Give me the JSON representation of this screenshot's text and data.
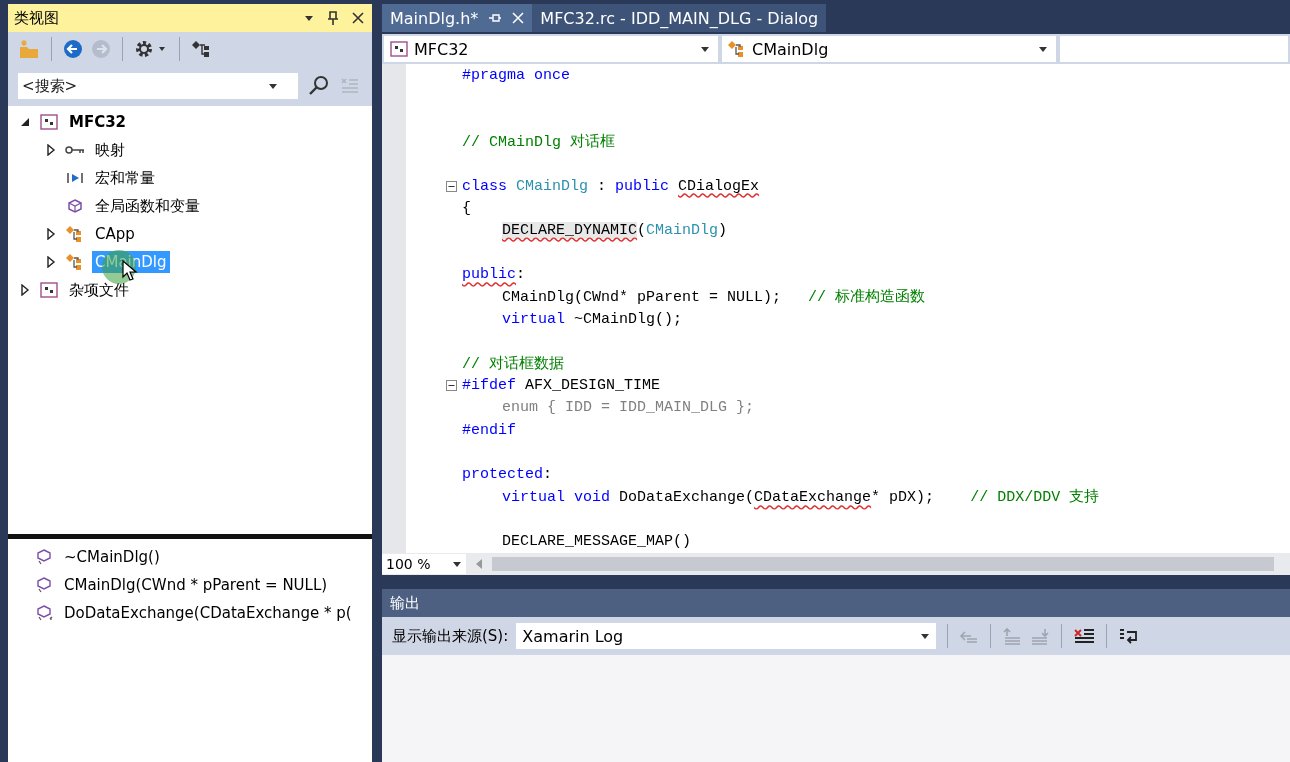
{
  "class_view": {
    "title": "类视图",
    "toolbar": [
      {
        "kind": "new-folder",
        "disabled": false
      },
      {
        "kind": "back",
        "disabled": false
      },
      {
        "kind": "forward",
        "disabled": true
      },
      {
        "kind": "settings",
        "disabled": false
      },
      {
        "kind": "class-diagram",
        "disabled": false
      }
    ],
    "search": {
      "placeholder": "<搜索>"
    },
    "tree": [
      {
        "label": "MFC32",
        "kind": "project",
        "startup": true,
        "expanded": true,
        "selected": false,
        "children": [
          {
            "label": "映射",
            "kind": "map",
            "expanded": false,
            "selected": false
          },
          {
            "label": "宏和常量",
            "kind": "macro",
            "selected": false
          },
          {
            "label": "全局函数和变量",
            "kind": "global",
            "selected": false
          },
          {
            "label": "CApp",
            "kind": "class",
            "expanded": false,
            "selected": false
          },
          {
            "label": "CMainDlg",
            "kind": "class",
            "expanded": false,
            "selected": true
          }
        ]
      },
      {
        "label": "杂项文件",
        "kind": "project",
        "startup": false,
        "expanded": false,
        "selected": false
      }
    ],
    "members": [
      {
        "label": "~CMainDlg()",
        "kind": "public"
      },
      {
        "label": "CMainDlg(CWnd * pParent = NULL)",
        "kind": "public"
      },
      {
        "label": "DoDataExchange(CDataExchange * p(",
        "kind": "protected"
      }
    ]
  },
  "editor": {
    "tabs": [
      {
        "label": "MainDlg.h*",
        "selected": true
      },
      {
        "label": "MFC32.rc - IDD_MAIN_DLG - Dialog",
        "selected": false
      }
    ],
    "nav": [
      {
        "kind": "project",
        "value": "MFC32"
      },
      {
        "kind": "class",
        "value": "CMainDlg"
      },
      {
        "kind": "empty"
      }
    ],
    "lines": [
      {
        "kind": "flush",
        "tokens": [
          {
            "t": "#pragma once",
            "kind": "keyword"
          }
        ]
      },
      {
        "kind": "blank"
      },
      {
        "kind": "blank"
      },
      {
        "kind": "flush",
        "tokens": [
          {
            "t": "// CMainDlg 对话框",
            "kind": "comment"
          }
        ]
      },
      {
        "kind": "blank"
      },
      {
        "kind": "flush",
        "collapsed": false,
        "tokens": [
          {
            "t": "class ",
            "kind": "keyword"
          },
          {
            "t": "CMainDlg",
            "kind": "type"
          },
          {
            "t": " : ",
            "kind": "plain"
          },
          {
            "t": "public ",
            "kind": "keyword"
          },
          {
            "t": "CDialogEx",
            "kind": "plain",
            "squiggle": true
          }
        ]
      },
      {
        "kind": "flush",
        "tokens": [
          {
            "t": "{",
            "kind": "plain"
          }
        ]
      },
      {
        "kind": "indented",
        "tokens": [
          {
            "t": "DECLARE_DYNAMIC",
            "kind": "plain",
            "squiggle": true,
            "highlight": true
          },
          {
            "t": "(",
            "kind": "plain"
          },
          {
            "t": "CMainDlg",
            "kind": "type"
          },
          {
            "t": ")",
            "kind": "plain"
          }
        ]
      },
      {
        "kind": "blank"
      },
      {
        "kind": "flush",
        "tokens": [
          {
            "t": "public",
            "kind": "keyword",
            "squiggle": true
          },
          {
            "t": ":",
            "kind": "plain"
          }
        ]
      },
      {
        "kind": "indented",
        "tokens": [
          {
            "t": "CMainDlg(CWnd* pParent = NULL);   ",
            "kind": "plain"
          },
          {
            "t": "// 标准构造函数",
            "kind": "comment"
          }
        ]
      },
      {
        "kind": "indented",
        "tokens": [
          {
            "t": "virtual ",
            "kind": "keyword"
          },
          {
            "t": "~CMainDlg();",
            "kind": "plain"
          }
        ]
      },
      {
        "kind": "blank"
      },
      {
        "kind": "flush",
        "tokens": [
          {
            "t": "// 对话框数据",
            "kind": "comment"
          }
        ]
      },
      {
        "kind": "flush",
        "collapsed": false,
        "tokens": [
          {
            "t": "#ifdef ",
            "kind": "keyword"
          },
          {
            "t": "AFX_DESIGN_TIME",
            "kind": "plain"
          }
        ]
      },
      {
        "kind": "indented",
        "tokens": [
          {
            "t": "enum { IDD = IDD_MAIN_DLG };",
            "kind": "inactive"
          }
        ]
      },
      {
        "kind": "flush",
        "tokens": [
          {
            "t": "#endif",
            "kind": "keyword"
          }
        ]
      },
      {
        "kind": "blank"
      },
      {
        "kind": "flush",
        "tokens": [
          {
            "t": "protected",
            "kind": "keyword"
          },
          {
            "t": ":",
            "kind": "plain"
          }
        ]
      },
      {
        "kind": "indented",
        "tokens": [
          {
            "t": "virtual void ",
            "kind": "keyword"
          },
          {
            "t": "DoDataExchange(",
            "kind": "plain"
          },
          {
            "t": "CDataExchange",
            "kind": "plain",
            "squiggle": true
          },
          {
            "t": "* pDX);    ",
            "kind": "plain"
          },
          {
            "t": "// DDX/DDV 支持",
            "kind": "comment"
          }
        ]
      },
      {
        "kind": "blank"
      },
      {
        "kind": "indented",
        "tokens": [
          {
            "t": "DECLARE_MESSAGE_MAP()",
            "kind": "plain"
          }
        ]
      }
    ],
    "zoom": "100 %"
  },
  "output": {
    "title": "输出",
    "source_label": "显示输出来源(S):",
    "source": "Xamarin Log",
    "toolbar": [
      {
        "kind": "goto-message",
        "disabled": true
      },
      {
        "kind": "prev-message",
        "disabled": true
      },
      {
        "kind": "next-message",
        "disabled": true
      },
      {
        "kind": "clear-all",
        "disabled": false
      },
      {
        "kind": "word-wrap",
        "disabled": false
      }
    ]
  }
}
